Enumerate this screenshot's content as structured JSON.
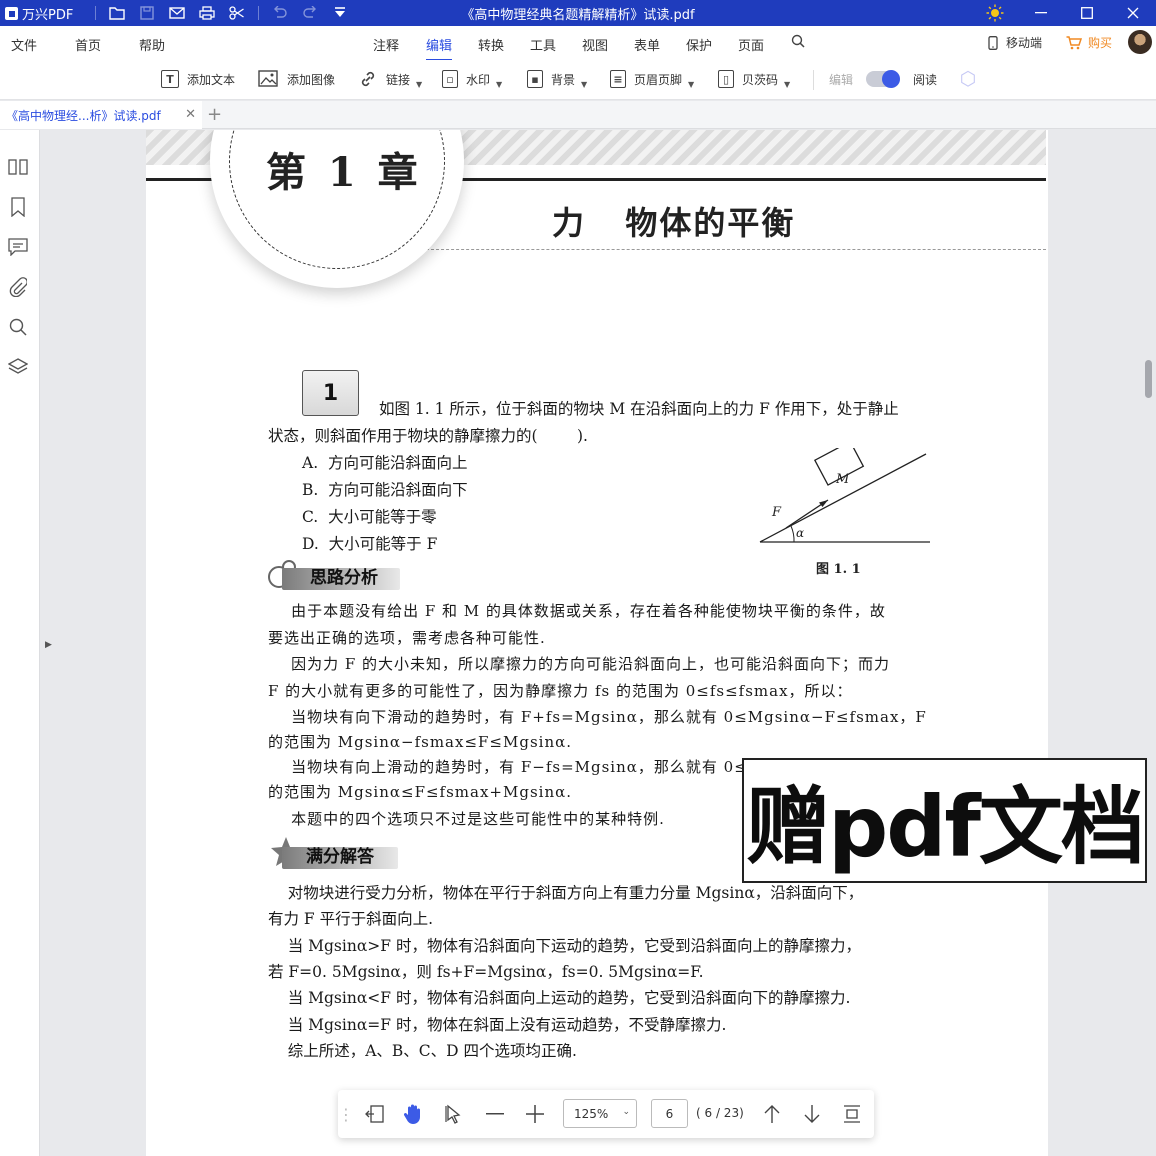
{
  "app": {
    "name": "万兴PDF",
    "window_title": "《高中物理经典名题精解精析》试读.pdf",
    "mobile_label": "移动端",
    "buy_label": "购买"
  },
  "menu": {
    "left": [
      "文件",
      "首页",
      "帮助"
    ],
    "center": [
      "注释",
      "编辑",
      "转换",
      "工具",
      "视图",
      "表单",
      "保护",
      "页面"
    ],
    "active": "编辑"
  },
  "toolbar": {
    "add_text": "添加文本",
    "add_image": "添加图像",
    "link": "链接",
    "watermark": "水印",
    "background": "背景",
    "header_footer": "页眉页脚",
    "bates": "贝茨码",
    "edit": "编辑",
    "read": "阅读"
  },
  "tab": {
    "name": "《高中物理经...析》试读.pdf"
  },
  "page": {
    "chapter_label": "第 1 章",
    "chapter_title": "力   物体的平衡",
    "question_number": "1",
    "question_line1": "如图 1. 1 所示，位于斜面的物块 M 在沿斜面向上的力 F 作用下，处于静止",
    "question_line2": "状态，则斜面作用于物块的静摩擦力的(        ).",
    "option_a": "A.  方向可能沿斜面向上",
    "option_b": "B.  方向可能沿斜面向下",
    "option_c": "C.  大小可能等于零",
    "option_d": "D.  大小可能等于 F",
    "figure_caption": "图 1. 1",
    "figure_mass_label": "M",
    "figure_force_label": "F",
    "figure_angle_label": "α",
    "analysis_heading": "思路分析",
    "analysis_lines": [
      "    由于本题没有给出 F 和 M 的具体数据或关系，存在着各种能使物块平衡的条件，故",
      "要选出正确的选项，需考虑各种可能性.",
      "    因为力 F 的大小未知，所以摩擦力的方向可能沿斜面向上，也可能沿斜面向下；而力",
      "F 的大小就有更多的可能性了，因为静摩擦力 fs 的范围为 0≤fs≤fsmax，所以：",
      "    当物块有向下滑动的趋势时，有 F+fs=Mgsinα，那么就有 0≤Mgsinα−F≤fsmax，F",
      "的范围为 Mgsinα−fsmax≤F≤Mgsinα.",
      "    当物块有向上滑动的趋势时，有 F−fs=Mgsinα，那么就有 0≤F−Mgsinα≤fsmax，F",
      "的范围为 Mgsinα≤F≤fsmax+Mgsinα.",
      "    本题中的四个选项只不过是这些可能性中的某种特例."
    ],
    "answer_heading": "满分解答",
    "answer_lines": [
      "    对物块进行受力分析，物体在平行于斜面方向上有重力分量 Mgsinα，沿斜面向下，",
      "有力 F 平行于斜面向上.",
      "    当 Mgsinα>F 时，物体有沿斜面向下运动的趋势，它受到沿斜面向上的静摩擦力，",
      "若 F=0. 5Mgsinα，则 fs+F=Mgsinα，fs=0. 5Mgsinα=F.",
      "    当 Mgsinα<F 时，物体有沿斜面向上运动的趋势，它受到沿斜面向下的静摩擦力.",
      "    当 Mgsinα=F 时，物体在斜面上没有运动趋势，不受静摩擦力.",
      "    综上所述，A、B、C、D 四个选项均正确."
    ]
  },
  "watermark_text": "赠pdf文档",
  "bottom_nav": {
    "zoom": "125%",
    "current_page": "6",
    "page_count": "( 6 / 23)"
  },
  "colors": {
    "titlebar": "#1f3cbd",
    "accent": "#2a4ce0",
    "buy": "#f08a24"
  }
}
